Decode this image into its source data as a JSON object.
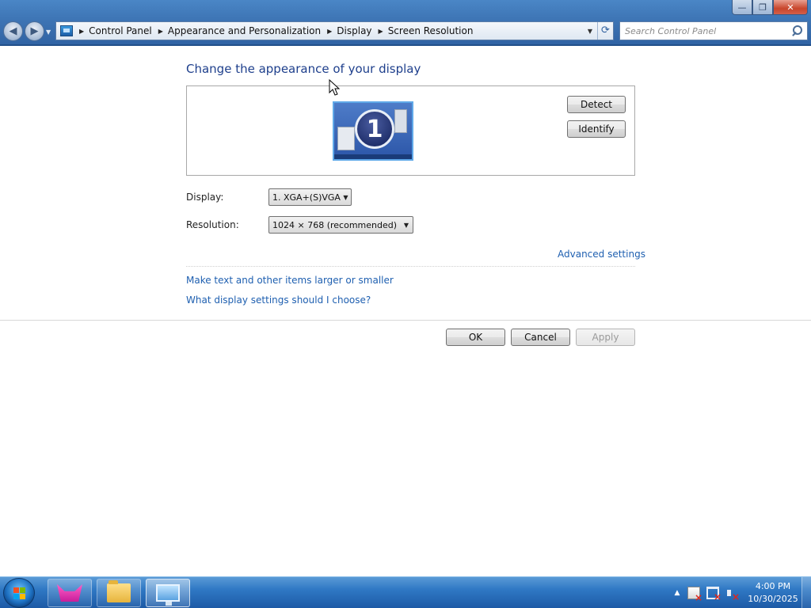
{
  "window": {
    "minimize_glyph": "—",
    "maximize_glyph": "❐",
    "close_glyph": "✕"
  },
  "nav": {
    "back_glyph": "◀",
    "forward_glyph": "▶",
    "breadcrumbs": [
      "Control Panel",
      "Appearance and Personalization",
      "Display",
      "Screen Resolution"
    ],
    "search_placeholder": "Search Control Panel"
  },
  "icons": {
    "address": "control-panel-icon",
    "refresh": "refresh-icon",
    "search": "search-icon"
  },
  "main": {
    "title": "Change the appearance of your display",
    "monitor_number": "1",
    "detect_label": "Detect",
    "identify_label": "Identify",
    "display_label": "Display:",
    "display_value": "1. XGA+(S)VGA",
    "resolution_label": "Resolution:",
    "resolution_value": "1024 × 768 (recommended)",
    "advanced_link": "Advanced settings",
    "link_text_size": "Make text and other items larger or smaller",
    "link_which_settings": "What display settings should I choose?"
  },
  "footer": {
    "ok_label": "OK",
    "cancel_label": "Cancel",
    "apply_label": "Apply"
  },
  "taskbar": {
    "pinned": [
      "fox-icon",
      "folder-icon",
      "display-settings-icon"
    ],
    "tray_arrow": "▲",
    "time": "4:00 PM",
    "date": "10/30/2025"
  },
  "colors": {
    "title_blue": "#1e3f8c",
    "link_blue": "#1e5fb0",
    "taskbar_blue": "#2f78c4",
    "close_red": "#c8452b"
  }
}
